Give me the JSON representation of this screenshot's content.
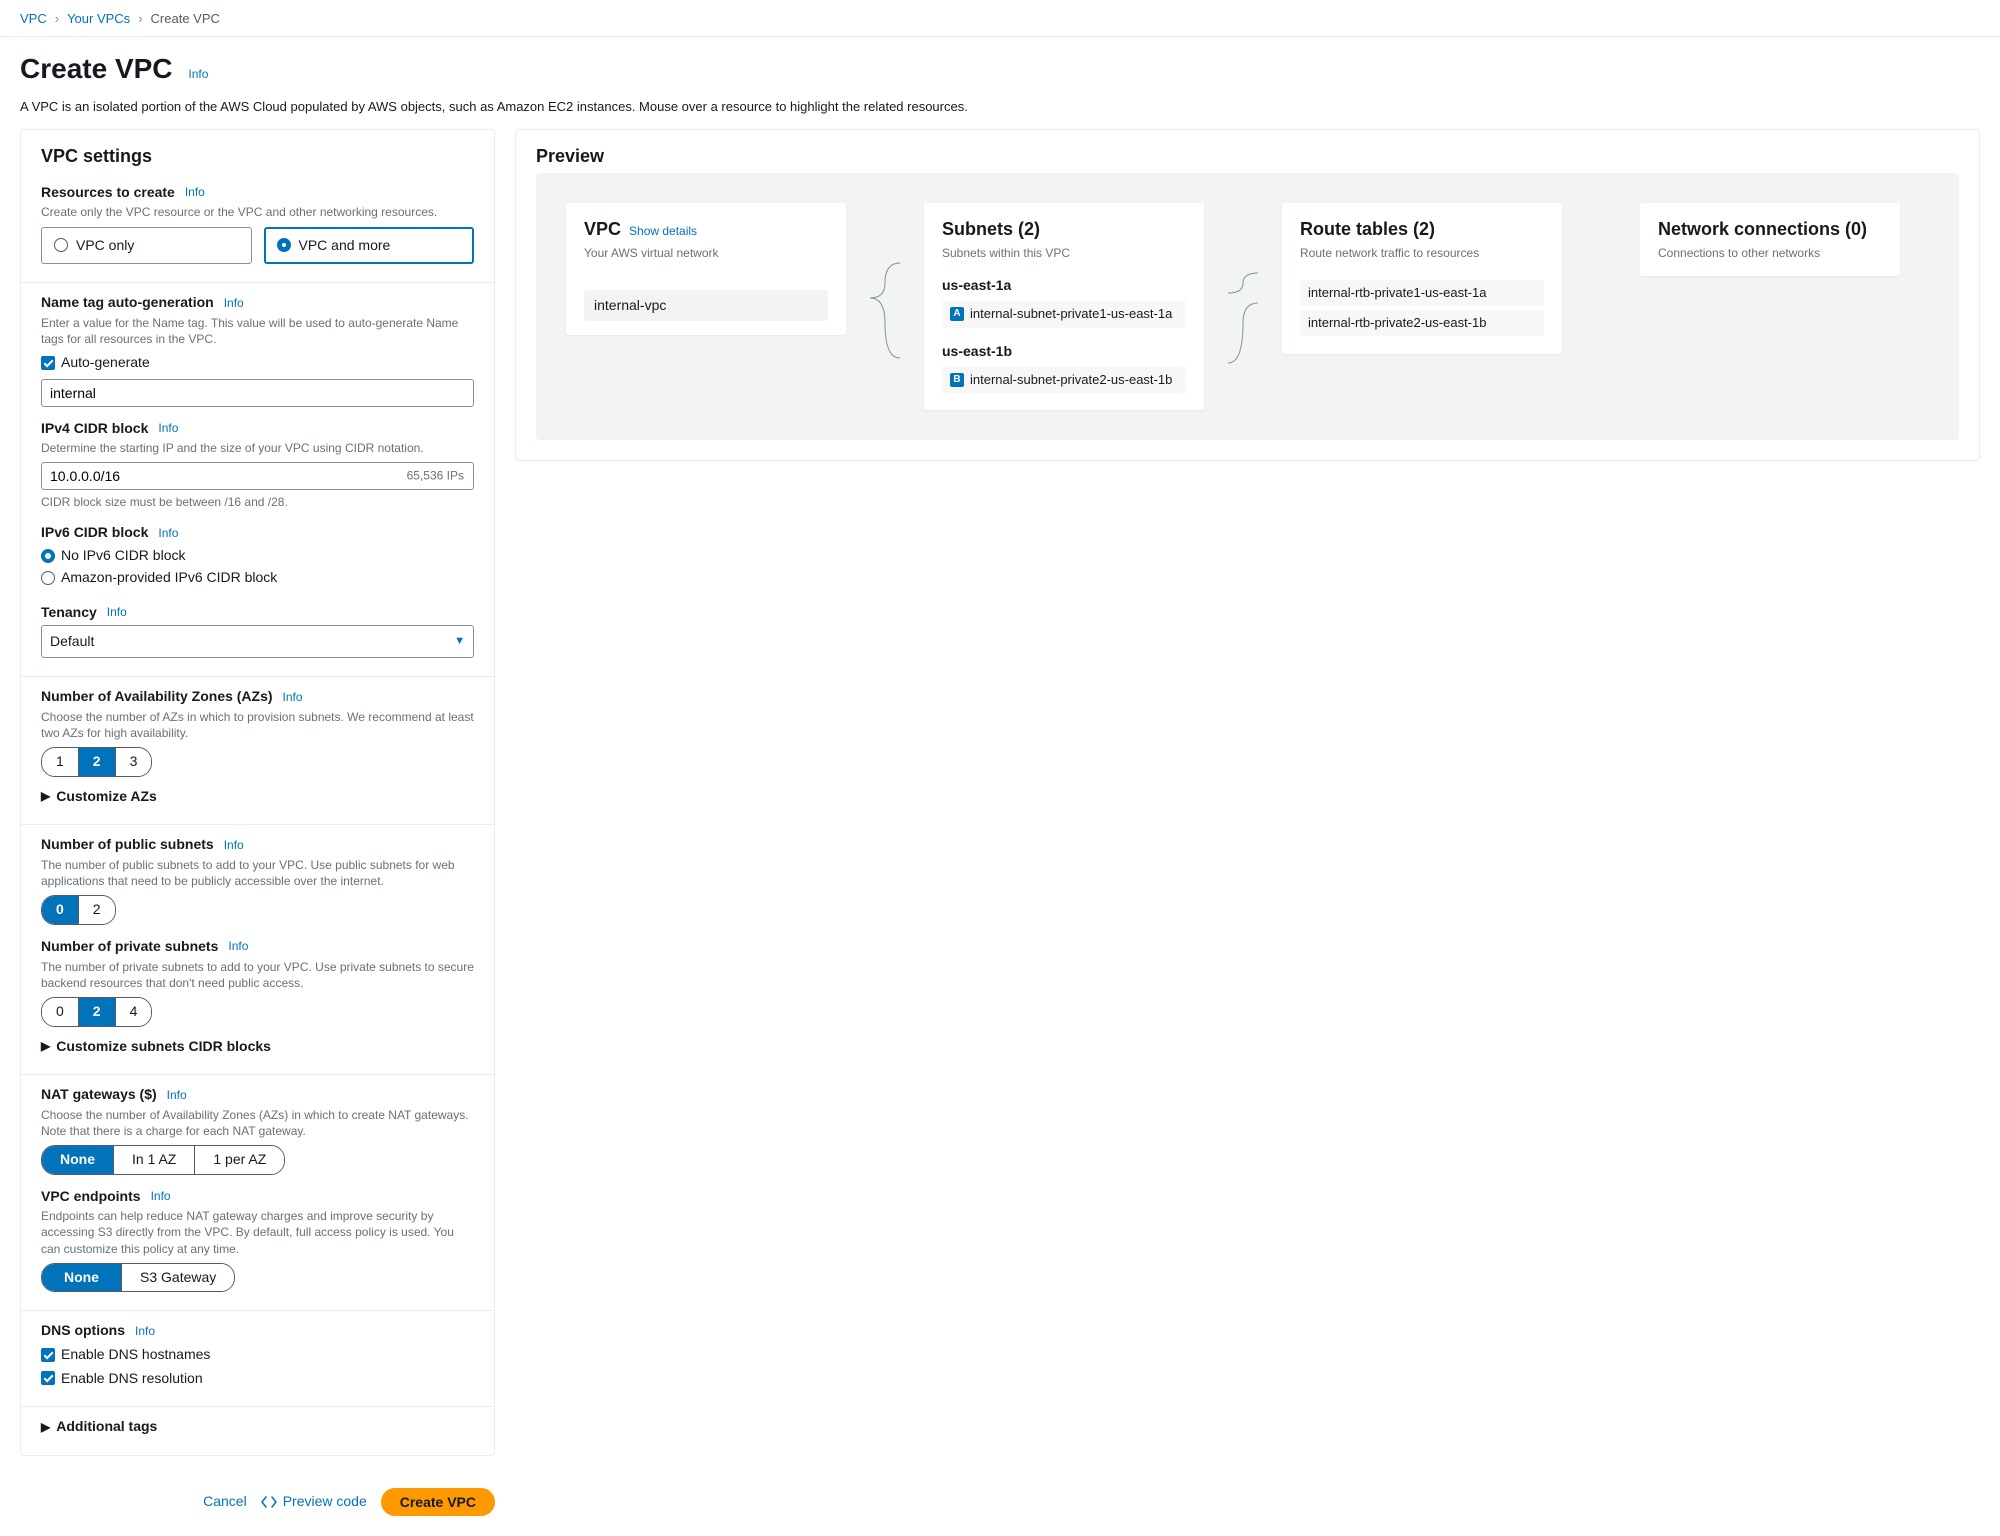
{
  "breadcrumb": {
    "root": "VPC",
    "yours": "Your VPCs",
    "current": "Create VPC"
  },
  "header": {
    "title": "Create VPC",
    "info": "Info",
    "desc": "A VPC is an isolated portion of the AWS Cloud populated by AWS objects, such as Amazon EC2 instances. Mouse over a resource to highlight the related resources."
  },
  "settings": {
    "panel_title": "VPC settings",
    "resources": {
      "label": "Resources to create",
      "info": "Info",
      "desc": "Create only the VPC resource or the VPC and other networking resources.",
      "opt_only": "VPC only",
      "opt_more": "VPC and more"
    },
    "nametag": {
      "label": "Name tag auto-generation",
      "info": "Info",
      "desc": "Enter a value for the Name tag. This value will be used to auto-generate Name tags for all resources in the VPC.",
      "auto_label": "Auto-generate",
      "value": "internal"
    },
    "ipv4": {
      "label": "IPv4 CIDR block",
      "info": "Info",
      "desc": "Determine the starting IP and the size of your VPC using CIDR notation.",
      "value": "10.0.0.0/16",
      "suffix": "65,536 IPs",
      "constraint": "CIDR block size must be between /16 and /28."
    },
    "ipv6": {
      "label": "IPv6 CIDR block",
      "info": "Info",
      "opt_none": "No IPv6 CIDR block",
      "opt_amz": "Amazon-provided IPv6 CIDR block"
    },
    "tenancy": {
      "label": "Tenancy",
      "info": "Info",
      "value": "Default"
    },
    "azs": {
      "label": "Number of Availability Zones (AZs)",
      "info": "Info",
      "desc": "Choose the number of AZs in which to provision subnets. We recommend at least two AZs for high availability.",
      "opts": [
        "1",
        "2",
        "3"
      ],
      "expand": "Customize AZs"
    },
    "pubs": {
      "label": "Number of public subnets",
      "info": "Info",
      "desc": "The number of public subnets to add to your VPC. Use public subnets for web applications that need to be publicly accessible over the internet.",
      "opts": [
        "0",
        "2"
      ]
    },
    "privs": {
      "label": "Number of private subnets",
      "info": "Info",
      "desc": "The number of private subnets to add to your VPC. Use private subnets to secure backend resources that don't need public access.",
      "opts": [
        "0",
        "2",
        "4"
      ],
      "expand": "Customize subnets CIDR blocks"
    },
    "nat": {
      "label": "NAT gateways ($)",
      "info": "Info",
      "desc": "Choose the number of Availability Zones (AZs) in which to create NAT gateways. Note that there is a charge for each NAT gateway.",
      "opts": [
        "None",
        "In 1 AZ",
        "1 per AZ"
      ]
    },
    "endpoints": {
      "label": "VPC endpoints",
      "info": "Info",
      "desc": "Endpoints can help reduce NAT gateway charges and improve security by accessing S3 directly from the VPC. By default, full access policy is used. You can customize this policy at any time.",
      "opts": [
        "None",
        "S3 Gateway"
      ]
    },
    "dns": {
      "label": "DNS options",
      "info": "Info",
      "hostnames": "Enable DNS hostnames",
      "resolution": "Enable DNS resolution"
    },
    "addtags": {
      "label": "Additional tags"
    }
  },
  "footer": {
    "cancel": "Cancel",
    "preview_code": "Preview code",
    "create": "Create VPC"
  },
  "preview": {
    "title": "Preview",
    "vpc": {
      "title": "VPC",
      "link": "Show details",
      "sub": "Your AWS virtual network",
      "chip": "internal-vpc"
    },
    "subnets": {
      "title": "Subnets (2)",
      "sub": "Subnets within this VPC",
      "az1": "us-east-1a",
      "s1": "internal-subnet-private1-us-east-1a",
      "az2": "us-east-1b",
      "s2": "internal-subnet-private2-us-east-1b"
    },
    "rt": {
      "title": "Route tables (2)",
      "sub": "Route network traffic to resources",
      "r1": "internal-rtb-private1-us-east-1a",
      "r2": "internal-rtb-private2-us-east-1b"
    },
    "net": {
      "title": "Network connections (0)",
      "sub": "Connections to other networks"
    }
  }
}
